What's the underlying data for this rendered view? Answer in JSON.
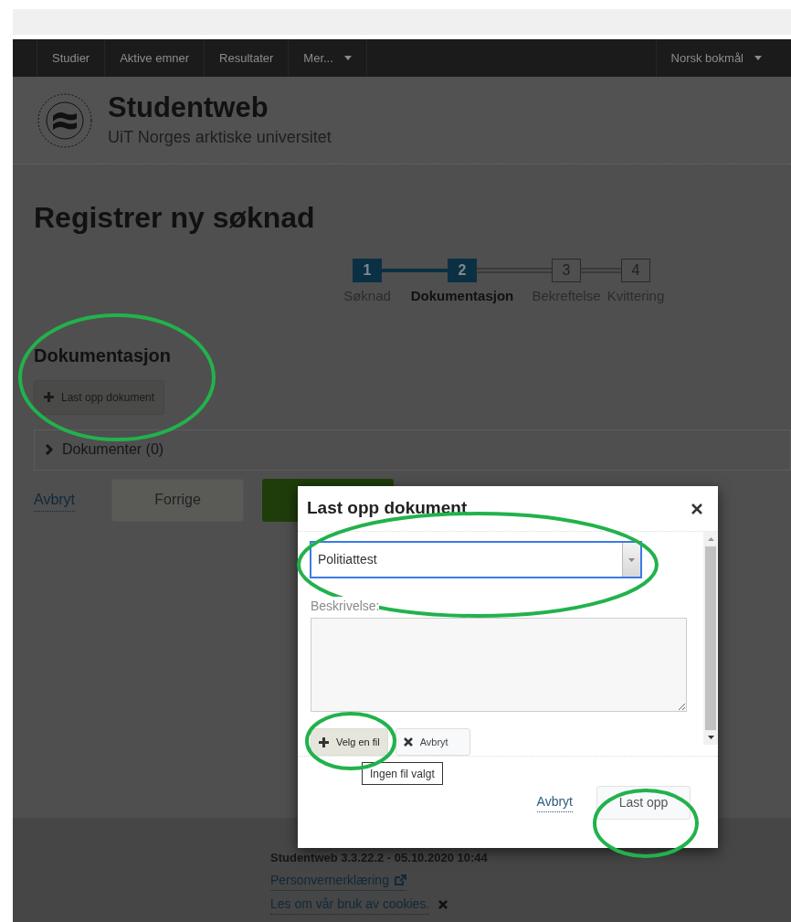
{
  "top_nav": {
    "items": [
      {
        "label": "Studier",
        "dropdown": false
      },
      {
        "label": "Aktive emner",
        "dropdown": false
      },
      {
        "label": "Resultater",
        "dropdown": false
      },
      {
        "label": "Mer...",
        "dropdown": true
      }
    ],
    "language": "Norsk bokmål"
  },
  "header": {
    "title": "Studentweb",
    "subtitle": "UiT Norges arktiske universitet"
  },
  "page_title": "Registrer ny søknad",
  "steps": [
    {
      "number": "1",
      "label": "Søknad",
      "completed": true,
      "selected": false
    },
    {
      "number": "2",
      "label": "Dokumentasjon",
      "completed": true,
      "selected": true
    },
    {
      "number": "3",
      "label": "Bekreftelse",
      "completed": false,
      "selected": false
    },
    {
      "number": "4",
      "label": "Kvittering",
      "completed": false,
      "selected": false
    }
  ],
  "section": {
    "title": "Dokumentasjon",
    "upload_button": "Last opp dokument",
    "documents_panel": {
      "label": "Dokumenter (0)",
      "expanded": false
    }
  },
  "actions": {
    "cancel_link": "Avbryt",
    "back_button": "Forrige"
  },
  "modal": {
    "title": "Last opp dokument",
    "document_type": {
      "value": "Politiattest"
    },
    "description_label": "Beskrivelse:",
    "choose_file_button": "Velg en fil",
    "clear_button": "Avbryt",
    "file_status": "Ingen fil valgt",
    "cancel_link": "Avbryt",
    "upload_button": "Last opp"
  },
  "footer": {
    "version": "Studentweb 3.3.22.2 - 05.10.2020 10:44",
    "privacy_link": "Personvernerklæring",
    "cookies_link": "Les om vår bruk av cookies."
  }
}
